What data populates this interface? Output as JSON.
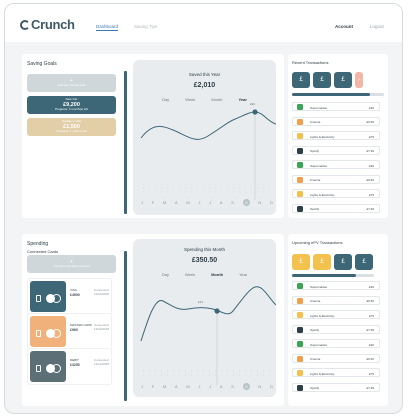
{
  "header": {
    "logo": "Crunch",
    "nav": [
      "Dashboard",
      "Saving Tips"
    ],
    "account": "Account",
    "logout": "Logout"
  },
  "saving_goals": {
    "title": "Saving Goals",
    "add_card": {
      "line1": "+",
      "line2": "Add new saving goal"
    },
    "goals": [
      {
        "name": "New Car",
        "amount": "£9,200",
        "progress": "Progress: 3 month(s) left"
      },
      {
        "name": "Holiday in Italy",
        "amount": "£1,500",
        "progress": "Progress: 1 year(s) left"
      }
    ],
    "chart": {
      "title": "Saved this Year",
      "value": "£2,010",
      "tabs": [
        "Day",
        "Week",
        "Month",
        "Year"
      ],
      "active_tab": "Year",
      "marker_label": "£90"
    }
  },
  "recent": {
    "title": "Recent Transactions",
    "rows": [
      {
        "icon": "shopping-icon",
        "color": "#3aa655",
        "label": "Supermarket",
        "amount": "£30"
      },
      {
        "icon": "cinema-icon",
        "color": "#f0a04b",
        "label": "Cinema",
        "amount": "£9.50"
      },
      {
        "icon": "lightbulb-icon",
        "color": "#f2c14e",
        "label": "Lights & Electricity",
        "amount": "£75"
      },
      {
        "icon": "music-icon",
        "color": "#2c3e46",
        "label": "Spotify",
        "amount": "£7.99"
      },
      {
        "icon": "shopping-icon",
        "color": "#3aa655",
        "label": "Supermarket",
        "amount": "£30"
      },
      {
        "icon": "cinema-icon",
        "color": "#f0a04b",
        "label": "Cinema",
        "amount": "£9.50"
      },
      {
        "icon": "lightbulb-icon",
        "color": "#f2c14e",
        "label": "Lights & Electricity",
        "amount": "£75"
      },
      {
        "icon": "music-icon",
        "color": "#2c3e46",
        "label": "Spotify",
        "amount": "£7.99"
      }
    ]
  },
  "spending": {
    "title": "Spending",
    "subtitle": "Connected Cards",
    "add_card": {
      "line1": "+",
      "line2": "Connect new bank account"
    },
    "cards": [
      {
        "color": "#3d6776",
        "type": "VISA",
        "number": "£4900",
        "conn": "Connected",
        "date": "12/12/2018"
      },
      {
        "color": "#f0b27a",
        "type": "MASTER CARD",
        "number": "£960",
        "conn": "Connected",
        "date": "12/12/2018"
      },
      {
        "color": "#5c6f77",
        "type": "DEBIT",
        "number": "£3250",
        "conn": "Connected",
        "date": "12/12/2018"
      }
    ],
    "chart": {
      "title": "Spending this Month",
      "value": "£350.50",
      "tabs": [
        "Day",
        "Week",
        "Month",
        "Year"
      ],
      "active_tab": "Month",
      "marker_label": "£24"
    }
  },
  "upcoming": {
    "title": "Upcoming ePV Transactions",
    "rows": [
      {
        "icon": "shopping-icon",
        "color": "#3aa655",
        "label": "Supermarket",
        "amount": "£30"
      },
      {
        "icon": "cinema-icon",
        "color": "#f0a04b",
        "label": "Cinema",
        "amount": "£9.50"
      },
      {
        "icon": "lightbulb-icon",
        "color": "#f2c14e",
        "label": "Lights & Electricity",
        "amount": "£75"
      },
      {
        "icon": "music-icon",
        "color": "#2c3e46",
        "label": "Spotify",
        "amount": "£7.99"
      },
      {
        "icon": "shopping-icon",
        "color": "#3aa655",
        "label": "Supermarket",
        "amount": "£30"
      },
      {
        "icon": "cinema-icon",
        "color": "#f0a04b",
        "label": "Cinema",
        "amount": "£9.50"
      },
      {
        "icon": "lightbulb-icon",
        "color": "#f2c14e",
        "label": "Lights & Electricity",
        "amount": "£75"
      },
      {
        "icon": "music-icon",
        "color": "#2c3e46",
        "label": "Spotify",
        "amount": "£7.99"
      }
    ]
  },
  "months": [
    "J",
    "F",
    "M",
    "A",
    "M",
    "J",
    "J",
    "A",
    "S",
    "O",
    "N",
    "D"
  ],
  "colors": {
    "accent": "#3d6776",
    "link": "#3b78b5",
    "goal_active": "#3d6776",
    "goal_tan": "#e2cfa8",
    "add_card": "#cfd7da"
  }
}
